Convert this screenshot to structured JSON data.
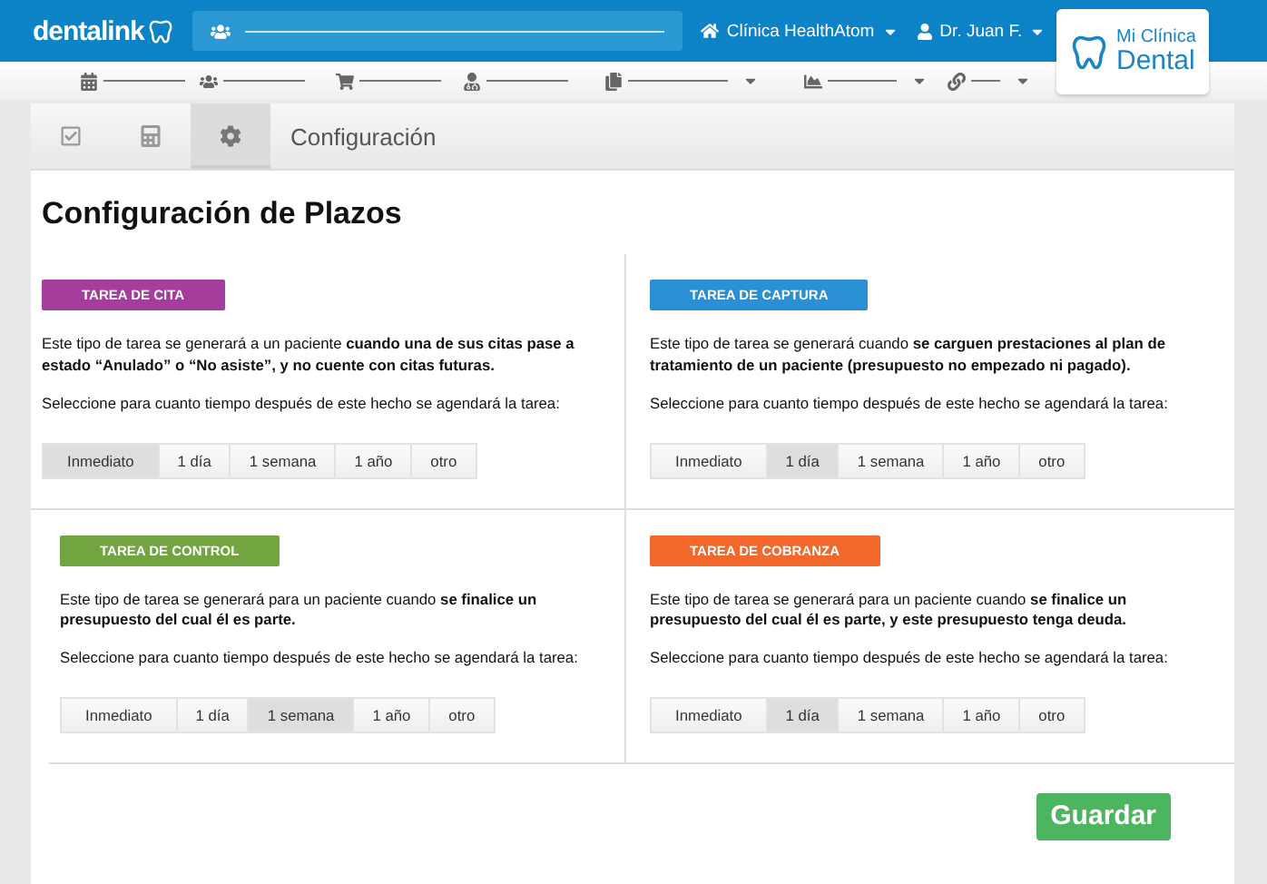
{
  "header": {
    "logo": "dentalink",
    "clinic": "Clínica HealthAtom",
    "user": "Dr. Juan F.",
    "brand": {
      "line_1": "Mi Clínica",
      "line_2": "Dental"
    }
  },
  "nav": [
    {
      "menu": false
    },
    {
      "menu": false
    },
    {
      "menu": false
    },
    {
      "menu": false
    },
    {
      "menu": true
    },
    {
      "menu": true
    },
    {
      "menu": true
    }
  ],
  "tabs": [
    {
      "selected": false
    },
    {
      "selected": false
    },
    {
      "selected": true
    }
  ],
  "section_title": "Configuración",
  "title": "Configuración de Plazos",
  "tasks": [
    {
      "label": "TAREA DE CITA",
      "color": "#a43d9c",
      "description": "Este tipo de tarea se generará a un paciente **cuando una de sus citas pase a estado “Anulado” o “No asiste”, y no cuente con citas futuras.**",
      "prompt": "Seleccione para cuanto tiempo después de este hecho se agendará la tarea:",
      "options": [
        {
          "label": "Inmediato",
          "selected": true
        },
        {
          "label": "1 día",
          "selected": false
        },
        {
          "label": "1 semana",
          "selected": false
        },
        {
          "label": "1 año",
          "selected": false
        },
        {
          "label": "otro",
          "selected": false
        }
      ]
    },
    {
      "label": "TAREA DE CAPTURA",
      "color": "#2a8fd4",
      "description": "Este tipo de tarea se generará cuando **se carguen prestaciones al plan de tratamiento de un paciente (presupuesto no empezado ni pagado).**",
      "prompt": "Seleccione para cuanto tiempo después de este hecho se agendará la tarea:",
      "options": [
        {
          "label": "Inmediato",
          "selected": false
        },
        {
          "label": "1 día",
          "selected": true
        },
        {
          "label": "1 semana",
          "selected": false
        },
        {
          "label": "1 año",
          "selected": false
        },
        {
          "label": "otro",
          "selected": false
        }
      ]
    },
    {
      "label": "TAREA DE CONTROL",
      "color": "#72a540",
      "description": "Este tipo de tarea se generará para un paciente cuando **se finalice un presupuesto del cual él es parte.**",
      "prompt": "Seleccione para cuanto tiempo después de este hecho se agendará la tarea:",
      "options": [
        {
          "label": "Inmediato",
          "selected": false
        },
        {
          "label": "1 día",
          "selected": false
        },
        {
          "label": "1 semana",
          "selected": true
        },
        {
          "label": "1 año",
          "selected": false
        },
        {
          "label": "otro",
          "selected": false
        }
      ]
    },
    {
      "label": "TAREA DE COBRANZA",
      "color": "#f2672a",
      "description": "Este tipo de tarea se generará para un paciente cuando **se finalice un presupuesto del cual él es parte, y este presupuesto tenga deuda.**",
      "prompt": "Seleccione para cuanto tiempo después de este hecho se agendará la tarea:",
      "options": [
        {
          "label": "Inmediato",
          "selected": false
        },
        {
          "label": "1 día",
          "selected": true
        },
        {
          "label": "1 semana",
          "selected": false
        },
        {
          "label": "1 año",
          "selected": false
        },
        {
          "label": "otro",
          "selected": false
        }
      ]
    }
  ],
  "save_button": "Guardar"
}
